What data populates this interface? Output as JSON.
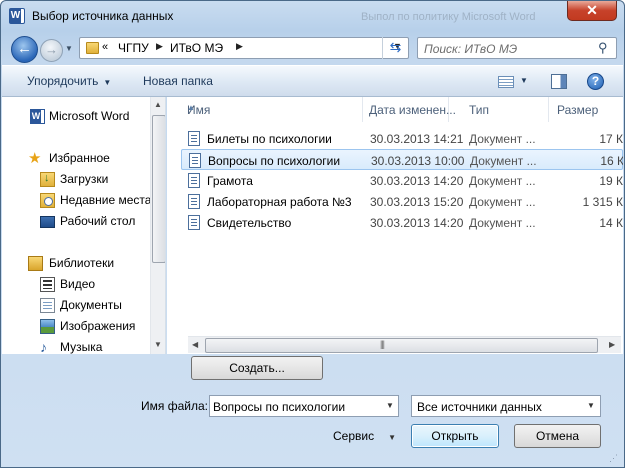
{
  "window": {
    "title": "Выбор источника данных",
    "title_icon": "W",
    "ghost_title": "Выпол по политику   Microsoft Word"
  },
  "nav": {
    "breadcrumb_prefix": "«",
    "breadcrumb": [
      "ЧГПУ",
      "ИТвО МЭ"
    ],
    "search_placeholder": "Поиск: ИТвО МЭ"
  },
  "toolbar": {
    "organize_label": "Упорядочить",
    "new_folder_label": "Новая папка",
    "help_label": "?"
  },
  "sidebar": {
    "items": [
      {
        "label": "Microsoft Word",
        "icon": "word-icon"
      },
      {
        "label": "Избранное",
        "icon": "star-icon"
      },
      {
        "label": "Загрузки",
        "icon": "downloads-icon"
      },
      {
        "label": "Недавние места",
        "icon": "recent-places-icon"
      },
      {
        "label": "Рабочий стол",
        "icon": "desktop-icon"
      },
      {
        "label": "Библиотеки",
        "icon": "libraries-icon"
      },
      {
        "label": "Видео",
        "icon": "video-icon"
      },
      {
        "label": "Документы",
        "icon": "documents-icon"
      },
      {
        "label": "Изображения",
        "icon": "images-icon"
      },
      {
        "label": "Музыка",
        "icon": "music-icon"
      }
    ]
  },
  "files": {
    "columns": [
      "Имя",
      "Дата изменен...",
      "Тип",
      "Размер"
    ],
    "rows": [
      {
        "name": "Билеты по психологии",
        "date": "30.03.2013 14:21",
        "type": "Документ ...",
        "size": "17 К"
      },
      {
        "name": "Вопросы по психологии",
        "date": "30.03.2013 10:00",
        "type": "Документ ...",
        "size": "16 К"
      },
      {
        "name": "Грамота",
        "date": "30.03.2013 14:20",
        "type": "Документ ...",
        "size": "19 К"
      },
      {
        "name": "Лабораторная работа №3",
        "date": "30.03.2013 15:20",
        "type": "Документ ...",
        "size": "1 315 К"
      },
      {
        "name": "Свидетельство",
        "date": "30.03.2013 14:20",
        "type": "Документ ...",
        "size": "14 К"
      }
    ],
    "selected_index": 1
  },
  "footer": {
    "create_label": "Создать...",
    "filename_label": "Имя файла:",
    "filename_value": "Вопросы по психологии",
    "filetype_value": "Все источники данных",
    "tools_label": "Сервис",
    "open_label": "Открыть",
    "cancel_label": "Отмена"
  },
  "colors": {
    "selection": "#d9ebfc",
    "selection_border": "#9cc5ef",
    "close_button": "#c7422a",
    "toolbar_text": "#1e395b"
  }
}
